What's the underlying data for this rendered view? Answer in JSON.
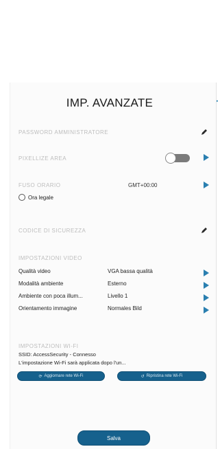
{
  "header": {
    "title": "IMP. AVANZATE"
  },
  "colors": {
    "accent": "#16618d",
    "arrow": "#2a7fb0",
    "faded_label": "#bdbdbd"
  },
  "settings": {
    "admin_password_label": "PASSWORD AMMINISTRATORE",
    "pixel_privacy_label": "PIXELLIZE AREA",
    "timezone_label": "FUSO ORARIO",
    "timezone_value": "GMT+00:00",
    "dst_label": "Ora legale",
    "security_code_label": "CODICE DI SICUREZZA",
    "video_section_label": "IMPOSTAZIONI VIDEO"
  },
  "video_rows": [
    {
      "name": "Qualità video",
      "value": "VGA bassa qualità"
    },
    {
      "name": "Modalità ambiente",
      "value": "Esterno"
    },
    {
      "name": "Ambiente con poca illum...",
      "value": "Livello 1"
    },
    {
      "name": "Orientamento immagine",
      "value": "Normales Bild"
    }
  ],
  "wifi": {
    "section_label": "IMPOSTAZIONI WI-FI",
    "ssid_line": "SSID: AccessSecurity - Connesso",
    "note_line": "L'impostazione Wi-Fi sarà applicata dopo l'un...",
    "button_left": "Aggiornare rete Wi-Fi",
    "button_right": "Ripristina rete Wi-Fi"
  },
  "footer": {
    "save_label": "Salva"
  },
  "icons": {
    "admin_password": "pencil-icon",
    "pixel_privacy_arrow": "arrow-right-icon",
    "timezone_arrow": "arrow-right-icon",
    "security_code": "pencil-icon",
    "video_arrow": "arrow-right-icon"
  }
}
